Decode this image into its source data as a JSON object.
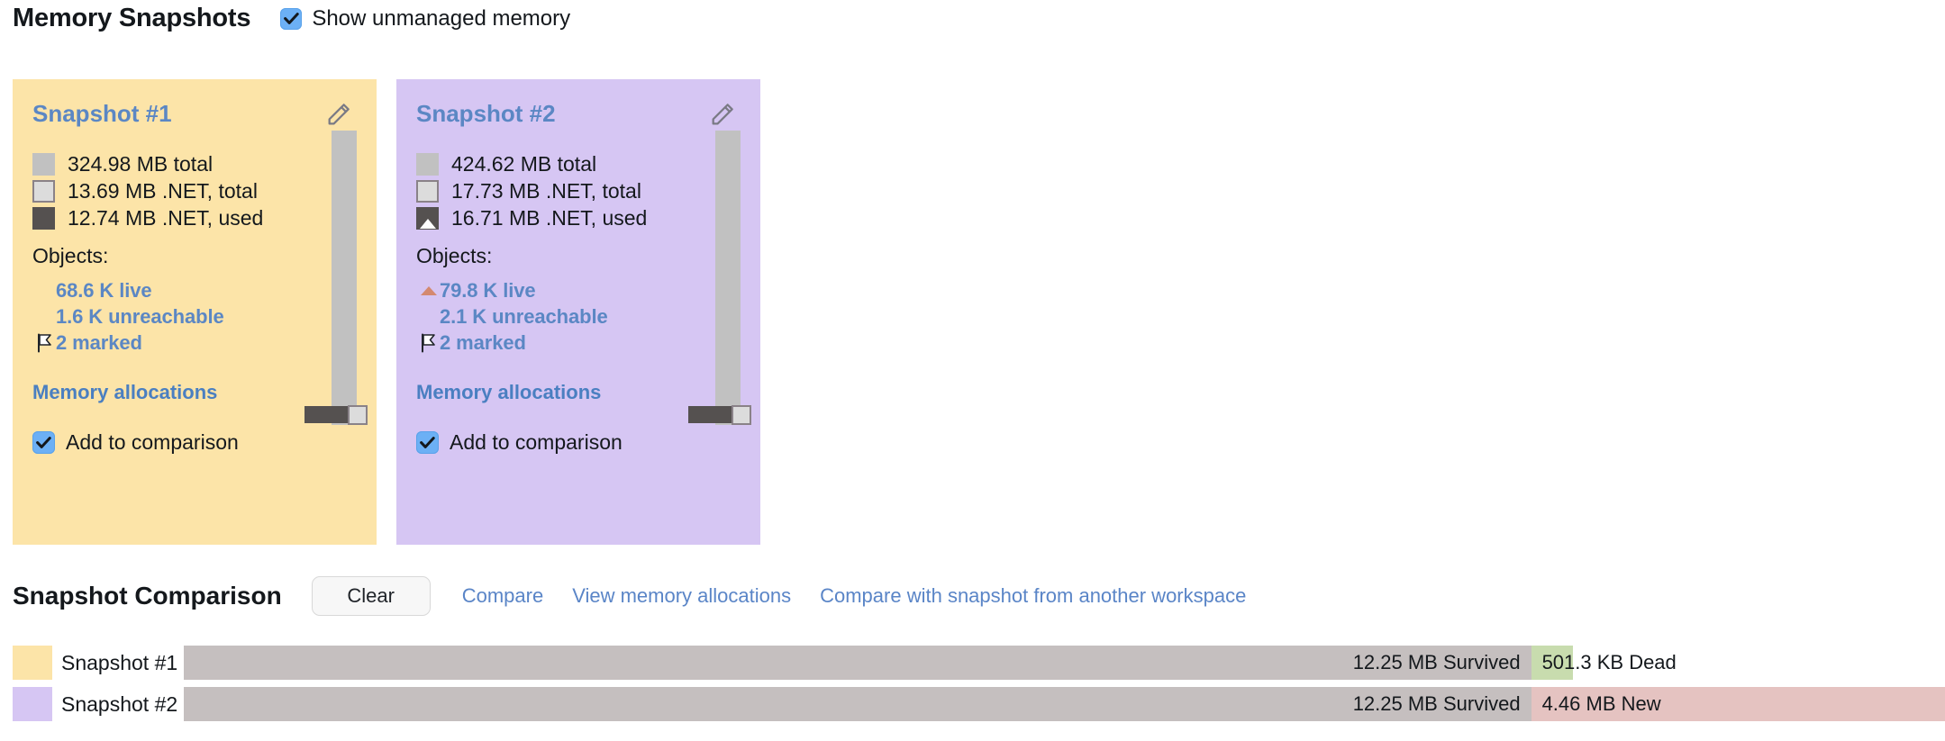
{
  "header": {
    "title": "Memory Snapshots",
    "unmanaged_checkbox_label": "Show unmanaged memory",
    "unmanaged_checked": true
  },
  "snapshots": [
    {
      "title": "Snapshot #1",
      "bg_color": "#fce4a8",
      "edit_icon": "pencil-icon",
      "legend": [
        {
          "swatch": "total-swatch",
          "text": "324.98 MB total"
        },
        {
          "swatch": "net-total-swatch",
          "text": "13.69 MB .NET, total"
        },
        {
          "swatch": "net-used-swatch",
          "text": "12.74 MB .NET, used"
        }
      ],
      "objects_label": "Objects:",
      "objects": [
        {
          "marker": "none",
          "text": "68.6 K live"
        },
        {
          "marker": "none",
          "text": "1.6 K unreachable"
        },
        {
          "marker": "flag-icon",
          "text": "2 marked"
        }
      ],
      "allocations_link": "Memory allocations",
      "add_to_comparison_label": "Add to comparison",
      "add_to_comparison_checked": true
    },
    {
      "title": "Snapshot #2",
      "bg_color": "#d6c6f3",
      "edit_icon": "pencil-icon",
      "legend": [
        {
          "swatch": "total-swatch",
          "text": "424.62 MB total"
        },
        {
          "swatch": "net-total-swatch",
          "text": "17.73 MB .NET, total"
        },
        {
          "swatch": "net-used-swatch",
          "text": "16.71 MB .NET, used"
        }
      ],
      "objects_label": "Objects:",
      "objects": [
        {
          "marker": "up-triangle-icon",
          "text": "79.8 K live"
        },
        {
          "marker": "none",
          "text": "2.1 K unreachable"
        },
        {
          "marker": "flag-icon",
          "text": "2 marked"
        }
      ],
      "allocations_link": "Memory allocations",
      "add_to_comparison_label": "Add to comparison",
      "add_to_comparison_checked": true
    }
  ],
  "comparison": {
    "title": "Snapshot Comparison",
    "clear_button": "Clear",
    "links": [
      "Compare",
      "View memory allocations",
      "Compare with snapshot from another workspace"
    ],
    "rows": [
      {
        "name": "Snapshot #1",
        "swatch_color": "#fce4a8",
        "survived_label": "12.25 MB Survived",
        "survived_pct": 76.5,
        "second_label": "501.3 KB Dead",
        "second_kind": "dead",
        "second_pct": 2.4,
        "second_color": "#c8dcae"
      },
      {
        "name": "Snapshot #2",
        "swatch_color": "#d6c6f3",
        "survived_label": "12.25 MB Survived",
        "survived_pct": 76.5,
        "second_label": "4.46 MB New",
        "second_kind": "new",
        "second_pct": 23.5,
        "second_color": "#e5c3c1"
      }
    ]
  },
  "colors": {
    "accent_blue": "#5b87c4",
    "link_blue": "#5a85c7",
    "survived_gray": "#c5bfbf",
    "dead_green": "#c8dcae",
    "new_pink": "#e5c3c1",
    "checkbox_blue": "#6cb0f5"
  }
}
